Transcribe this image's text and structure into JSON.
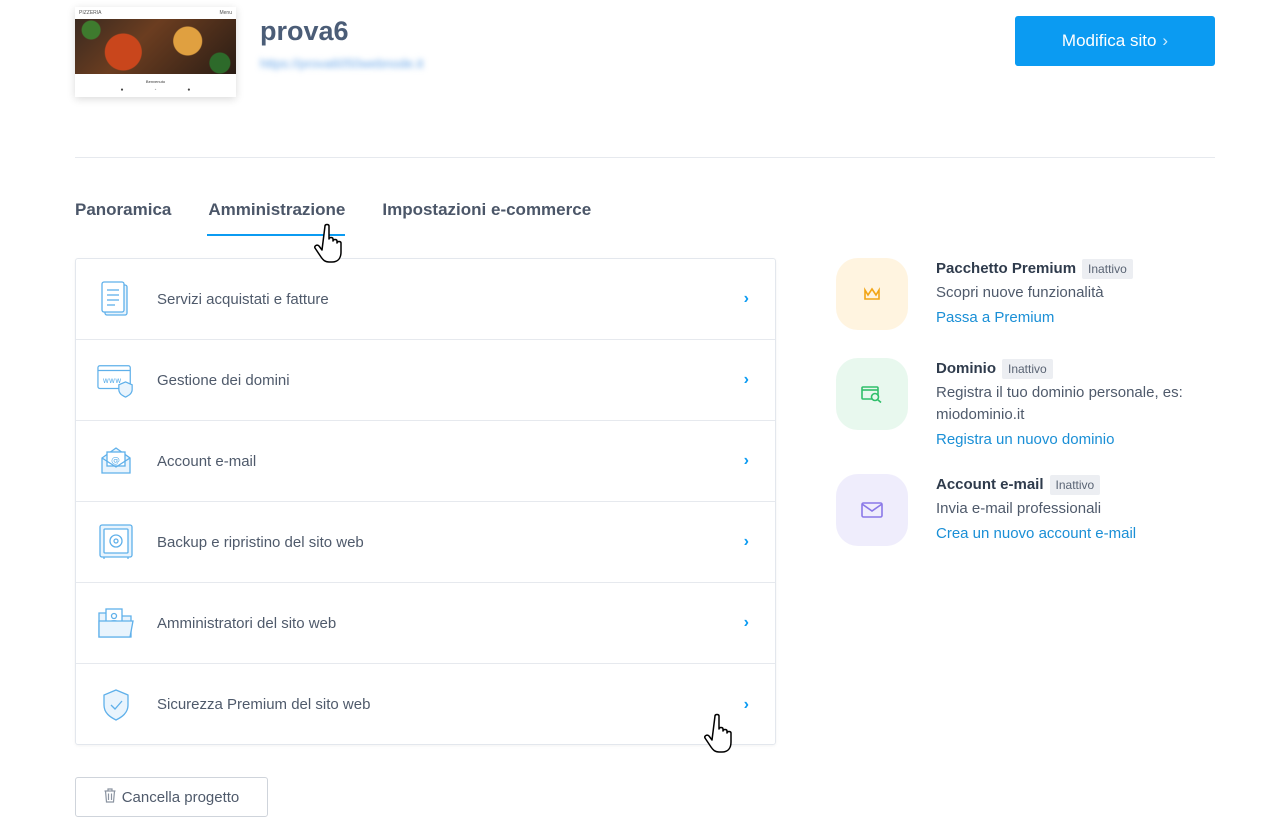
{
  "header": {
    "thumbnail": {
      "brand": "PIZZERIA",
      "menu": "Menu",
      "caption": "Benvenuto"
    },
    "title": "prova6",
    "url": "https://prova6050webnode.it",
    "edit_button": "Modifica sito"
  },
  "tabs": [
    {
      "label": "Panoramica",
      "active": false
    },
    {
      "label": "Amministrazione",
      "active": true
    },
    {
      "label": "Impostazioni e-commerce",
      "active": false
    }
  ],
  "admin_items": [
    {
      "label": "Servizi acquistati e fatture",
      "icon": "invoice-icon"
    },
    {
      "label": "Gestione dei domini",
      "icon": "www-shield-icon"
    },
    {
      "label": "Account e-mail",
      "icon": "email-envelope-icon"
    },
    {
      "label": "Backup e ripristino del sito web",
      "icon": "safe-icon"
    },
    {
      "label": "Amministratori del sito web",
      "icon": "admin-folder-icon"
    },
    {
      "label": "Sicurezza Premium del sito web",
      "icon": "security-shield-icon"
    }
  ],
  "features": [
    {
      "title": "Pacchetto Premium",
      "badge": "Inattivo",
      "desc": "Scopri nuove funzionalità",
      "link": "Passa a Premium",
      "icon": "crown-icon",
      "bg": "#fff4e0",
      "color": "#f2a516"
    },
    {
      "title": "Dominio",
      "badge": "Inattivo",
      "desc": "Registra il tuo dominio personale, es: miodominio.it",
      "link": "Registra un nuovo dominio",
      "icon": "domain-search-icon",
      "bg": "#e8f8ee",
      "color": "#2fbf6a"
    },
    {
      "title": "Account e-mail",
      "badge": "Inattivo",
      "desc": "Invia e-mail professionali",
      "link": "Crea un nuovo account e-mail",
      "icon": "mail-icon",
      "bg": "#efedfc",
      "color": "#8a78e8"
    }
  ],
  "delete_button": "Cancella progetto",
  "colors": {
    "accent": "#0b9bf2",
    "link": "#1a8fd6"
  }
}
